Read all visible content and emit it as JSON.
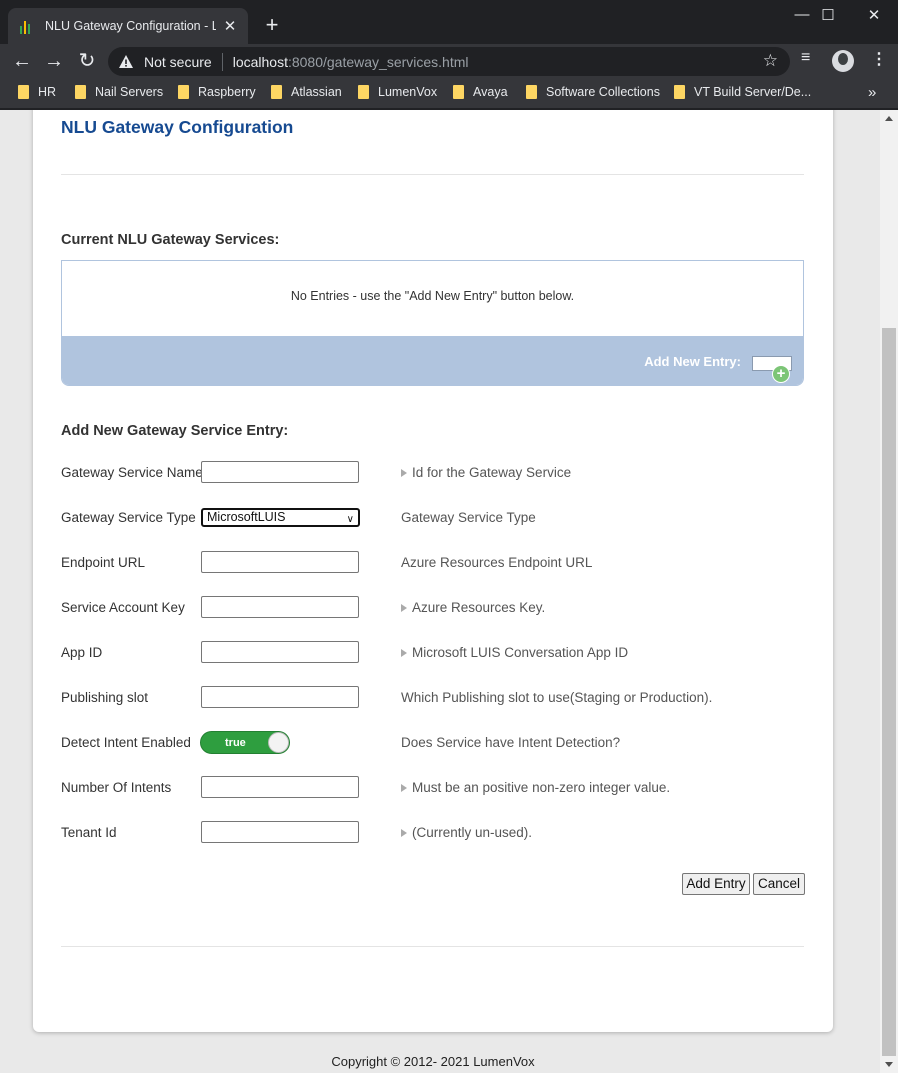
{
  "browser": {
    "tab_title": "NLU Gateway Configuration - Lur",
    "tab_close": "✕",
    "new_tab": "+",
    "security_text": "Not secure",
    "url_host": "localhost",
    "url_path": ":8080/gateway_services.html",
    "bookmarks": [
      "HR",
      "Nail Servers",
      "Raspberry",
      "Atlassian",
      "LumenVox",
      "Avaya",
      "Software Collections",
      "VT Build Server/De..."
    ],
    "bookmarks_more": "»"
  },
  "page": {
    "title": "NLU Gateway Configuration",
    "current_services_title": "Current NLU Gateway Services:",
    "empty_message": "No Entries - use the \"Add New Entry\" button below.",
    "add_new_entry_label": "Add New Entry:",
    "form_title": "Add New Gateway Service Entry:",
    "footer": "Copyright © 2012- 2021 LumenVox"
  },
  "form": {
    "fields": [
      {
        "label": "Gateway Service Name",
        "value": "",
        "help": "Id for the Gateway Service",
        "help_arrow": true
      },
      {
        "label": "Gateway Service Type",
        "value": "MicrosoftLUIS",
        "help": "Gateway Service Type",
        "help_arrow": false
      },
      {
        "label": "Endpoint URL",
        "value": "",
        "help": "Azure Resources Endpoint URL",
        "help_arrow": false
      },
      {
        "label": "Service Account Key",
        "value": "",
        "help": "Azure Resources Key.",
        "help_arrow": true
      },
      {
        "label": "App ID",
        "value": "",
        "help": "Microsoft LUIS Conversation App ID",
        "help_arrow": true
      },
      {
        "label": "Publishing slot",
        "value": "",
        "help": "Which Publishing slot to use(Staging or Production).",
        "help_arrow": false
      },
      {
        "label": "Detect Intent Enabled",
        "value": "true",
        "help": "Does Service have Intent Detection?",
        "help_arrow": false
      },
      {
        "label": "Number Of Intents",
        "value": "",
        "help": "Must be an positive non-zero integer value.",
        "help_arrow": true
      },
      {
        "label": "Tenant Id",
        "value": "",
        "help": "(Currently un-used).",
        "help_arrow": true
      }
    ],
    "add_button": "Add Entry",
    "cancel_button": "Cancel"
  },
  "colors": {
    "title_blue": "#164a91",
    "list_header": "#b0c4de",
    "toggle_green": "#2e9e3f"
  }
}
